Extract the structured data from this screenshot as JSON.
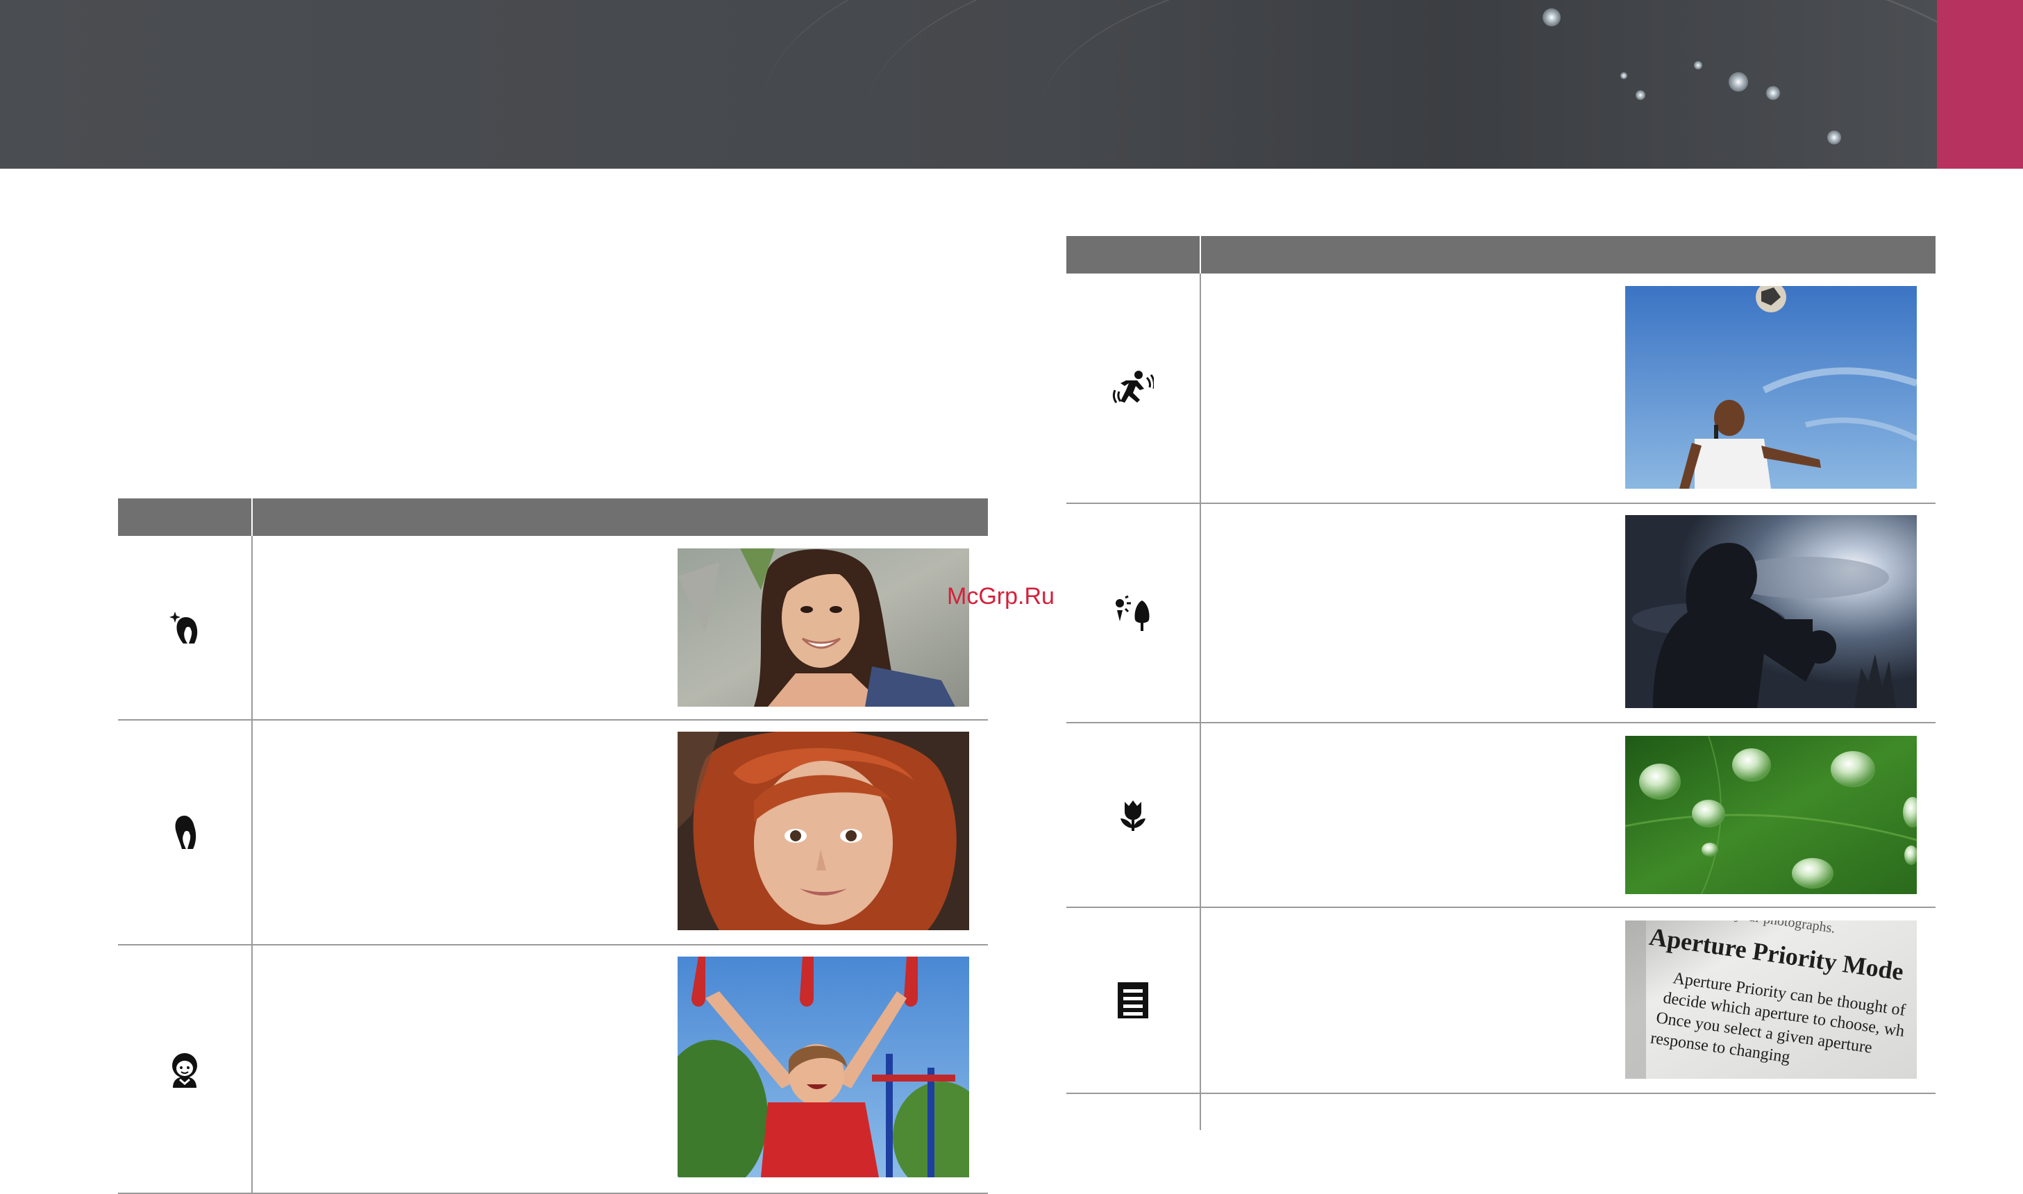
{
  "watermark": "McGrp.Ru",
  "colors": {
    "header": "#45484c",
    "tab_marker": "#b8325f",
    "table_header": "#707070",
    "divider": "#9a9a9a",
    "watermark": "#d4203a"
  },
  "left_table": {
    "rows": [
      {
        "icon": "beauty-face-icon",
        "photo": "smiling-woman-portrait"
      },
      {
        "icon": "portrait-icon",
        "photo": "red-haired-child-portrait"
      },
      {
        "icon": "children-icon",
        "photo": "child-on-playground-rings"
      }
    ]
  },
  "right_table": {
    "rows": [
      {
        "icon": "sports-action-icon",
        "photo": "soccer-player-heading-ball"
      },
      {
        "icon": "backlight-icon",
        "photo": "silhouette-photographer-against-sky"
      },
      {
        "icon": "macro-flower-icon",
        "photo": "water-drops-on-leaf"
      },
      {
        "icon": "text-document-icon",
        "photo": "book-page-aperture-priority"
      }
    ],
    "book_photo_text": {
      "line_top": "of your photographs.",
      "heading": "Aperture Priority Mode",
      "line1": "Aperture Priority can be thought of",
      "line2": "decide which aperture to choose, wh",
      "line3": "Once you select a given aperture",
      "line4": "response to changing"
    }
  }
}
